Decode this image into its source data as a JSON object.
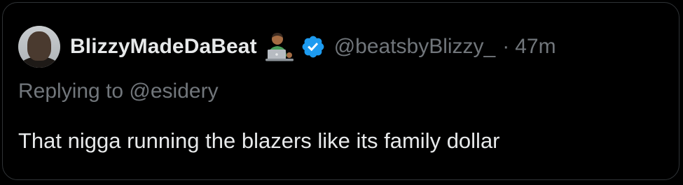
{
  "tweet": {
    "display_name": "BlizzyMadeDaBeat",
    "name_emoji": "technologist-icon",
    "verified": true,
    "handle": "@beatsbyBlizzy_",
    "separator": "·",
    "timestamp": "47m",
    "replying_to": "Replying to @esidery",
    "text": "That nigga running the blazers like its family dollar"
  },
  "colors": {
    "background": "#000000",
    "border": "#2f3336",
    "primary_text": "#e7e9ea",
    "secondary_text": "#71767b",
    "verified_blue": "#1d9bf0"
  }
}
